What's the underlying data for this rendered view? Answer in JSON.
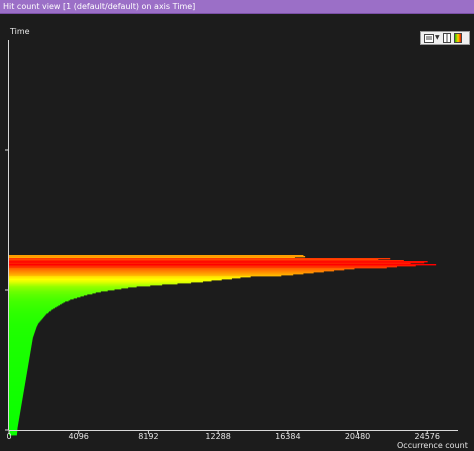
{
  "window": {
    "title": "Hit count view [1 (default/default) on axis Time]"
  },
  "view": {
    "y_axis_label": "Time",
    "x_axis_label": "Occurrence count",
    "background": "#1c1c1c"
  },
  "toolbar": {
    "items": [
      {
        "icon": "layout-menu-icon",
        "has_dropdown": true
      },
      {
        "icon": "mode-toggle-icon"
      },
      {
        "icon": "color-scale-icon"
      }
    ]
  },
  "chart_data": {
    "type": "bar",
    "orientation": "horizontal",
    "xlabel": "Occurrence count",
    "ylabel": "Time",
    "x_ticks": [
      0,
      4096,
      8192,
      12288,
      16384,
      20480,
      24576
    ],
    "xlim": [
      0,
      26500
    ],
    "y_ticks_count": 3,
    "color_scale": [
      "#00ff00",
      "#ffff00",
      "#ff0000"
    ],
    "note": "values are occurrence counts per time bucket, top bucket first; estimated",
    "values": [
      17300,
      17400,
      16800,
      22400,
      21700,
      23200,
      24600,
      24400,
      23600,
      25100,
      23900,
      22800,
      22200,
      20300,
      19700,
      19100,
      18500,
      17900,
      17300,
      16700,
      16000,
      14200,
      13600,
      13100,
      12500,
      11900,
      11400,
      10700,
      9900,
      9000,
      8300,
      7500,
      7000,
      6600,
      6200,
      5800,
      5400,
      5100,
      4900,
      4600,
      4400,
      4200,
      4000,
      3800,
      3600,
      3500,
      3300,
      3200,
      3100,
      3000,
      2900,
      2800,
      2700,
      2600,
      2500,
      2450,
      2350,
      2300,
      2200,
      2150,
      2100,
      2050,
      2000,
      1950,
      1900,
      1850,
      1800,
      1750,
      1700,
      1680,
      1650,
      1620,
      1600,
      1580,
      1560,
      1540,
      1520,
      1500,
      1480,
      1460,
      1440,
      1420,
      1400,
      1390,
      1380,
      1370,
      1360,
      1350,
      1340,
      1330,
      1320,
      1310,
      1300,
      1290,
      1280,
      1270,
      1260,
      1250,
      1240,
      1230,
      1220,
      1210,
      1200,
      1190,
      1180,
      1170,
      1160,
      1150,
      1140,
      1130,
      1120,
      1110,
      1100,
      1090,
      1080,
      1070,
      1060,
      1050,
      1040,
      1030,
      1020,
      1010,
      1000,
      990,
      980,
      970,
      960,
      950,
      940,
      930,
      920,
      910,
      900,
      890,
      880,
      870,
      860,
      850,
      840,
      830,
      820,
      810,
      800,
      790,
      780,
      770,
      760,
      750,
      740,
      730,
      720,
      710,
      700,
      690,
      680,
      670,
      660,
      650,
      640,
      630,
      620,
      610,
      600,
      590,
      580,
      570,
      560,
      550,
      540,
      530,
      520,
      510,
      500,
      495,
      490,
      485,
      480,
      475,
      470,
      465
    ]
  }
}
